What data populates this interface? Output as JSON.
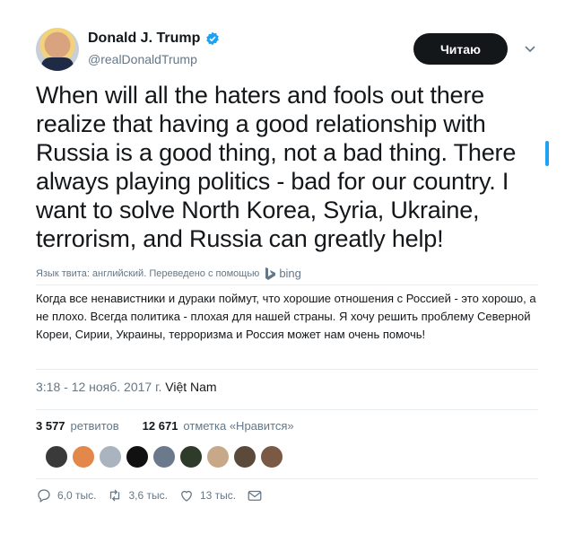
{
  "author": {
    "display_name": "Donald J. Trump",
    "handle": "@realDonaldTrump",
    "verified_icon": "verified-badge-icon"
  },
  "follow_button": {
    "label": "Читаю"
  },
  "tweet": {
    "text": "When will all the haters and fools out there realize that having a good relationship with Russia is a good thing, not a bad thing. There always playing politics - bad for our country. I want to solve North Korea, Syria, Ukraine, terrorism, and Russia can greatly help!"
  },
  "translation": {
    "meta": "Язык твита: английский. Переведено с помощью",
    "provider": "bing",
    "text": "Когда все ненавистники и дураки поймут, что хорошие отношения с Россией - это хорошо, а не плохо. Всегда политика - плохая для нашей страны. Я хочу решить проблему Северной Кореи, Сирии, Украины, терроризма и Россия может нам очень помочь!"
  },
  "timestamp": "3:18 - 12 нояб. 2017 г.",
  "location": "Việt Nam",
  "stats": {
    "retweets_count": "3 577",
    "retweets_label": "ретвитов",
    "likes_count": "12 671",
    "likes_label": "отметка «Нравится»"
  },
  "likers": [
    {
      "color": "#3a3a3a"
    },
    {
      "color": "#e4874a"
    },
    {
      "color": "#aab4c0"
    },
    {
      "color": "#111111"
    },
    {
      "color": "#6a7a8c"
    },
    {
      "color": "#2e3b2a"
    },
    {
      "color": "#c7a98a"
    },
    {
      "color": "#5b4a3a"
    },
    {
      "color": "#7a5a44"
    }
  ],
  "actions": {
    "reply_count": "6,0 тыс.",
    "retweet_count": "3,6 тыс.",
    "like_count": "13 тыс."
  },
  "colors": {
    "accent": "#1da1f2",
    "text": "#14171a",
    "muted": "#657786"
  }
}
